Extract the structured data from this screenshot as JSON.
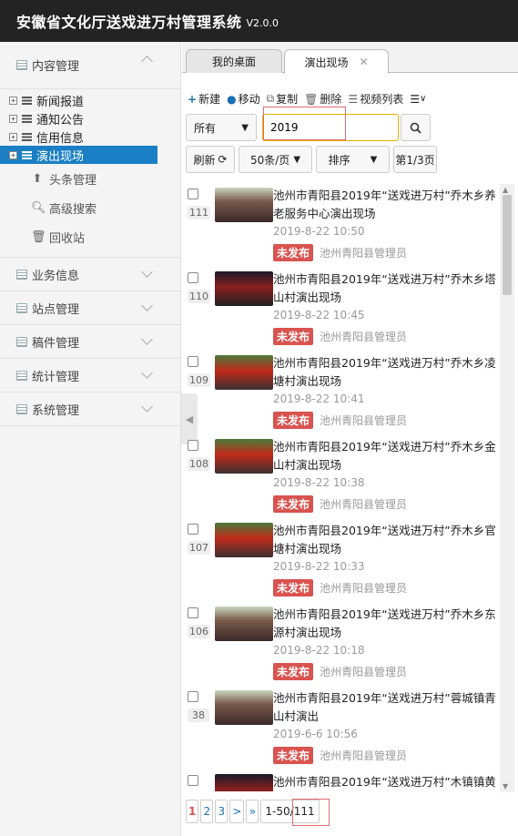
{
  "header": {
    "title": "安徽省文化厅送戏进万村管理系统",
    "version": "V2.0.0"
  },
  "sidebar": {
    "groups": [
      {
        "label": "内容管理"
      },
      {
        "label": "业务信息"
      },
      {
        "label": "站点管理"
      },
      {
        "label": "稿件管理"
      },
      {
        "label": "统计管理"
      },
      {
        "label": "系统管理"
      }
    ],
    "tree": [
      {
        "label": "新闻报道"
      },
      {
        "label": "通知公告"
      },
      {
        "label": "信用信息"
      },
      {
        "label": "演出现场"
      }
    ],
    "subs": [
      {
        "label": "头条管理"
      },
      {
        "label": "高级搜索"
      },
      {
        "label": "回收站"
      }
    ]
  },
  "tabs": [
    {
      "label": "我的桌面"
    },
    {
      "label": "演出现场"
    }
  ],
  "toolbar": {
    "new": "新建",
    "move": "移动",
    "copy": "复制",
    "delete": "删除",
    "video_list": "视频列表"
  },
  "filter": {
    "scope": "所有",
    "search_value": "2019"
  },
  "actions": {
    "refresh": "刷新",
    "page_size": "50条/页",
    "sort": "排序",
    "page_info": "第1/3页"
  },
  "items": [
    {
      "count": "111",
      "title": "池州市青阳县2019年“送戏进万村”乔木乡养老服务中心演出现场",
      "date": "2019-8-22 10:50",
      "status": "未发布",
      "org": "池州青阳县管理员"
    },
    {
      "count": "110",
      "title": "池州市青阳县2019年“送戏进万村”乔木乡塔山村演出现场",
      "date": "2019-8-22 10:45",
      "status": "未发布",
      "org": "池州青阳县管理员"
    },
    {
      "count": "109",
      "title": "池州市青阳县2019年“送戏进万村”乔木乡凌塘村演出现场",
      "date": "2019-8-22 10:41",
      "status": "未发布",
      "org": "池州青阳县管理员"
    },
    {
      "count": "108",
      "title": "池州市青阳县2019年“送戏进万村”乔木乡金山村演出现场",
      "date": "2019-8-22 10:38",
      "status": "未发布",
      "org": "池州青阳县管理员"
    },
    {
      "count": "107",
      "title": "池州市青阳县2019年“送戏进万村”乔木乡官塘村演出现场",
      "date": "2019-8-22 10:33",
      "status": "未发布",
      "org": "池州青阳县管理员"
    },
    {
      "count": "106",
      "title": "池州市青阳县2019年“送戏进万村”乔木乡东源村演出现场",
      "date": "2019-8-22 10:18",
      "status": "未发布",
      "org": "池州青阳县管理员"
    },
    {
      "count": "38",
      "title": "池州市青阳县2019年“送戏进万村”蓉城镇青山村演出",
      "date": "2019-6-6 10:56",
      "status": "未发布",
      "org": "池州青阳县管理员"
    },
    {
      "count": "",
      "title": "池州市青阳县2019年“送戏进万村”木镇镇黄",
      "date": "",
      "status": "",
      "org": ""
    }
  ],
  "pager": {
    "p1": "1",
    "p2": "2",
    "p3": "3",
    "next": ">",
    "last": "»",
    "range": "1-50/111"
  }
}
